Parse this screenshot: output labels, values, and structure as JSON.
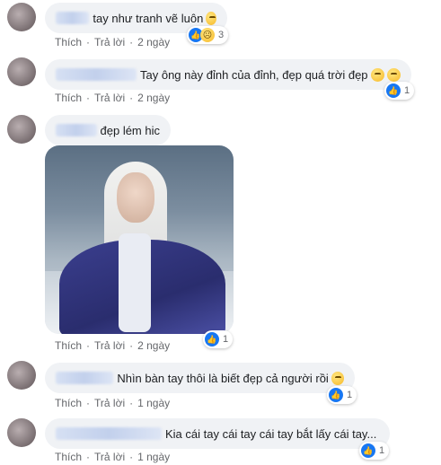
{
  "comments": [
    {
      "text": "tay như tranh vẽ luôn",
      "actions": {
        "like": "Thích",
        "reply": "Trả lời",
        "time": "2 ngày"
      },
      "reaction_count": "3"
    },
    {
      "text": "Tay ông này đỉnh của đỉnh, đẹp quá trời đẹp",
      "actions": {
        "like": "Thích",
        "reply": "Trả lời",
        "time": "2 ngày"
      },
      "reaction_count": "1"
    },
    {
      "text": "đẹp lém hic",
      "actions": {
        "like": "Thích",
        "reply": "Trả lời",
        "time": "2 ngày"
      },
      "reaction_count": "1"
    },
    {
      "text": "Nhìn bàn tay thôi là biết đẹp cả người rồi",
      "actions": {
        "like": "Thích",
        "reply": "Trả lời",
        "time": "1 ngày"
      },
      "reaction_count": "1"
    },
    {
      "text": "Kia cái tay cái tay cái tay bắt lấy cái tay...",
      "actions": {
        "like": "Thích",
        "reply": "Trả lời",
        "time": "1 ngày"
      },
      "reaction_count": "1"
    }
  ],
  "icons": {
    "like": "like-icon",
    "sad": "sad-reaction-icon",
    "emoji": "emoji-icon"
  },
  "colors": {
    "like_blue": "#1877f2",
    "bubble_bg": "#f0f2f5",
    "meta_gray": "#65676b"
  }
}
